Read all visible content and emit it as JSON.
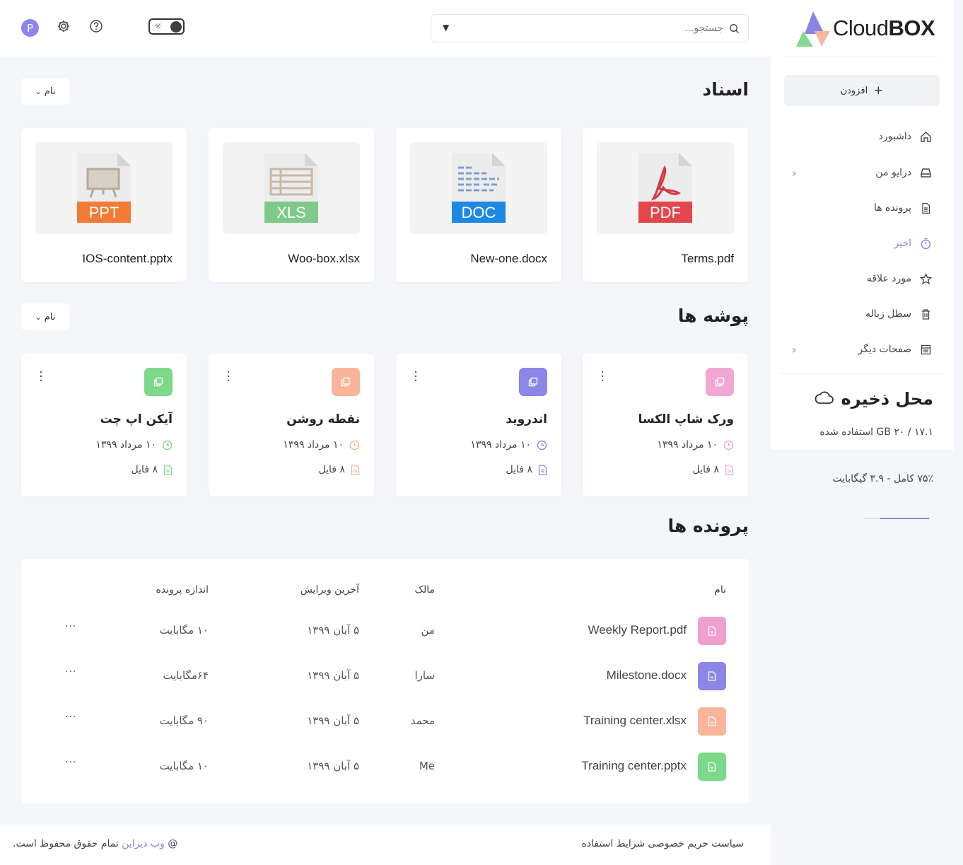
{
  "brand": {
    "name_light": "Cloud",
    "name_bold": "BOX"
  },
  "header": {
    "search_placeholder": "جستجو...",
    "avatar_letter": "P"
  },
  "sidebar": {
    "add_label": "افزودن",
    "items": [
      {
        "label": "داشبورد",
        "icon": "home-icon",
        "has_children": false,
        "active": false
      },
      {
        "label": "درایو من",
        "icon": "drive-icon",
        "has_children": true,
        "active": false
      },
      {
        "label": "پرونده ها",
        "icon": "file-icon",
        "has_children": false,
        "active": false
      },
      {
        "label": "اخیر",
        "icon": "timer-icon",
        "has_children": false,
        "active": true
      },
      {
        "label": "مورد علاقه",
        "icon": "star-icon",
        "has_children": false,
        "active": false
      },
      {
        "label": "سطل زباله",
        "icon": "trash-icon",
        "has_children": false,
        "active": false
      },
      {
        "label": "صفحات دیگر",
        "icon": "pages-icon",
        "has_children": true,
        "active": false
      }
    ],
    "storage": {
      "title": "محل ذخیره",
      "used_text": "۱۷.۱ / ۲۰ GB استفاده شده",
      "full_text": "۷۵٪ کامل - ۳.۹ گیگابایت",
      "percent": 75
    }
  },
  "documents": {
    "title": "اسناد",
    "sort_label": "نام",
    "items": [
      {
        "name": "Terms.pdf",
        "type_label": "PDF",
        "color": "#e4474b"
      },
      {
        "name": "New-one.docx",
        "type_label": "DOC",
        "color": "#1e88e5"
      },
      {
        "name": "Woo-box.xlsx",
        "type_label": "XLS",
        "color": "#7fc98a"
      },
      {
        "name": "IOS-content.pptx",
        "type_label": "PPT",
        "color": "#f47b35"
      }
    ]
  },
  "folders": {
    "title": "پوشه ها",
    "sort_label": "نام",
    "items": [
      {
        "name": "ورک شاپ الکسا",
        "date": "۱۰ مرداد ۱۳۹۹",
        "count": "۸ فایل",
        "color": "#f2a6d3"
      },
      {
        "name": "اندروید",
        "date": "۱۰ مرداد ۱۳۹۹",
        "count": "۸ فایل",
        "color": "#8b86e8"
      },
      {
        "name": "نقطه روشن",
        "date": "۱۰ مرداد ۱۳۹۹",
        "count": "۸ فایل",
        "color": "#f9b59a"
      },
      {
        "name": "آیکن اپ چت",
        "date": "۱۰ مرداد ۱۳۹۹",
        "count": "۸ فایل",
        "color": "#7dd88a"
      }
    ]
  },
  "files": {
    "title": "پرونده ها",
    "columns": {
      "name": "نام",
      "owner": "مالک",
      "modified": "آخرین ویرایش",
      "size": "اندازه پرونده"
    },
    "rows": [
      {
        "name": "Weekly Report.pdf",
        "owner": "من",
        "modified": "۵ آبان ۱۳۹۹",
        "size": "۱۰ مگابایت",
        "color": "#f0a0cc"
      },
      {
        "name": "Milestone.docx",
        "owner": "سارا",
        "modified": "۵ آبان ۱۳۹۹",
        "size": "۶۴مگابایت",
        "color": "#8b86e8"
      },
      {
        "name": "Training center.xlsx",
        "owner": "محمد",
        "modified": "۵ آبان ۱۳۹۹",
        "size": "۹۰ مگابایت",
        "color": "#f9b59a"
      },
      {
        "name": "Training center.pptx",
        "owner": "Me",
        "modified": "۵ آبان ۱۳۹۹",
        "size": "۱۰ مگابایت",
        "color": "#7dd88a"
      }
    ],
    "more_label": "..."
  },
  "footer": {
    "copyright_prefix": "@",
    "brand": "وب دیزاین",
    "copyright_suffix": "تمام حقوق محفوظ است.",
    "privacy": "سیاست حریم خصوصی",
    "terms": "شرایط استفاده"
  }
}
